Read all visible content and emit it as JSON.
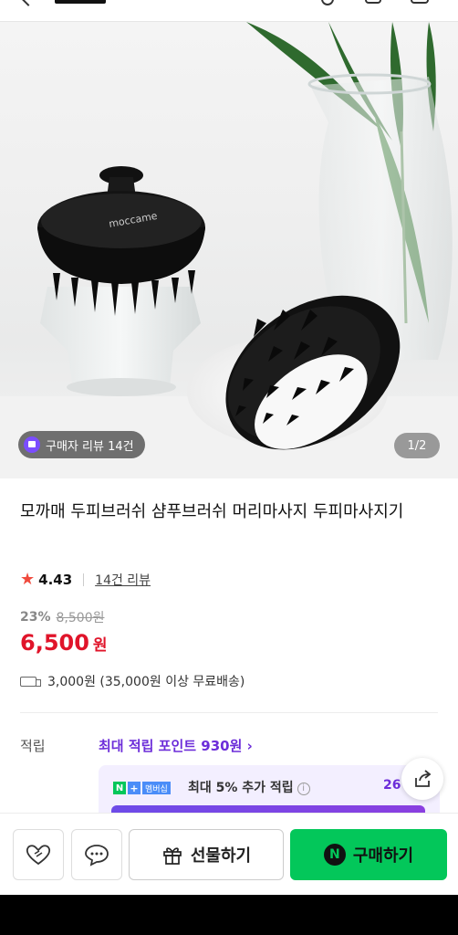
{
  "hero": {
    "review_chip": "구매자 리뷰 14건",
    "counter": "1/2",
    "brush_brand_text": "moccame"
  },
  "product": {
    "title": "모까매 두피브러쉬 샴푸브러쉬 머리마사지 두피마사지기",
    "rating": "4.43",
    "review_link": "14건 리뷰",
    "discount": "23%",
    "original_price": "8,500원",
    "price": "6,500",
    "price_unit": "원",
    "shipping": "3,000원 (35,000원 이상 무료배송)"
  },
  "points": {
    "label": "적립",
    "max_link": "최대 적립 포인트 930원 ›",
    "np_badge_n": "N",
    "np_badge_plus": "+",
    "np_badge_tag": "멤버십",
    "np_text": "최대 5% 추가 적립",
    "np_info": "i",
    "np_amount": "26"
  },
  "bottom": {
    "gift_label": "선물하기",
    "buy_label": "구매하기",
    "buy_n": "N"
  },
  "colors": {
    "price": "#e0142a",
    "accent": "#6c2dd9",
    "buy": "#03c75a"
  }
}
